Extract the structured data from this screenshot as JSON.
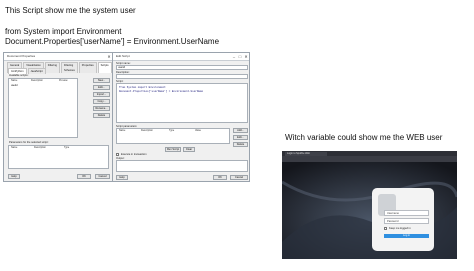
{
  "captions": {
    "line1": "This Script show me the system user",
    "line2": "from System import Environment",
    "line3": "Document.Properties['userName'] = Environment.UserName",
    "right": "Witch variable could show me the WEB user"
  },
  "doc_props": {
    "title": "Document Properties",
    "tabs": [
      "General",
      "Visualization",
      "Filtering",
      "Filtering Schemes",
      "Properties",
      "Scripts"
    ],
    "subtab": "IronPython",
    "subtab2": "JavaScript",
    "list_label": "Available scripts:",
    "cols": [
      "Name",
      "Description",
      "Preview"
    ],
    "script_name": "userid",
    "side_buttons": [
      "New...",
      "Edit...",
      "Import...",
      "Copy...",
      "Rename...",
      "Delete"
    ],
    "params_label": "Parameters for the selected script:",
    "param_cols": [
      "Name",
      "Description",
      "Type"
    ],
    "help": "Help",
    "ok": "OK",
    "cancel": "Cancel"
  },
  "edit_script": {
    "title": "Edit Script",
    "name_label": "Script name:",
    "name_value": "userid",
    "desc_label": "Description:",
    "script_label": "Script:",
    "code1": "from System import Environment",
    "code2": "Document.Properties['userName'] = Environment.UserName",
    "params_label": "Script parameters:",
    "param_cols": [
      "Name",
      "Description",
      "Type",
      "Value"
    ],
    "side_buttons": [
      "Add...",
      "Edit...",
      "Delete"
    ],
    "run_button": "Run Script",
    "clear_button": "Clear",
    "checkbox_label": "Execute in transaction",
    "output_label": "Output:",
    "help": "Help",
    "ok": "OK",
    "cancel": "Cancel"
  },
  "web_shot": {
    "tab_title": "Login to Spotfire Web",
    "username_placeholder": "Username",
    "password_placeholder": "Password",
    "remember_label": "Keep me logged in",
    "login_button": "Log in"
  }
}
